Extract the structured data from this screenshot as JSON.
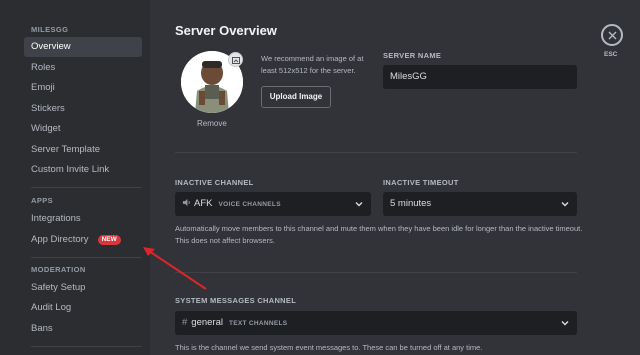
{
  "sidebar": {
    "server_header": "MILESGG",
    "items": [
      {
        "label": "Overview"
      },
      {
        "label": "Roles"
      },
      {
        "label": "Emoji"
      },
      {
        "label": "Stickers"
      },
      {
        "label": "Widget"
      },
      {
        "label": "Server Template"
      },
      {
        "label": "Custom Invite Link"
      }
    ],
    "apps_header": "APPS",
    "apps_items": [
      {
        "label": "Integrations"
      },
      {
        "label": "App Directory",
        "badge": "NEW"
      }
    ],
    "moderation_header": "MODERATION",
    "moderation_items": [
      {
        "label": "Safety Setup"
      },
      {
        "label": "Audit Log"
      },
      {
        "label": "Bans"
      }
    ]
  },
  "main": {
    "title": "Server Overview",
    "recommend_text": "We recommend an image of at least 512x512 for the server.",
    "upload_button": "Upload Image",
    "remove_label": "Remove",
    "server_name_label": "SERVER NAME",
    "server_name_value": "MilesGG",
    "inactive_channel_label": "INACTIVE CHANNEL",
    "inactive_channel_value": "AFK",
    "inactive_channel_sub": "VOICE CHANNELS",
    "inactive_timeout_label": "INACTIVE TIMEOUT",
    "inactive_timeout_value": "5 minutes",
    "inactive_help": "Automatically move members to this channel and mute them when they have been idle for longer than the inactive timeout. This does not affect browsers.",
    "system_channel_label": "SYSTEM MESSAGES CHANNEL",
    "system_channel_value": "general",
    "system_channel_sub": "TEXT CHANNELS",
    "system_help": "This is the channel we send system event messages to. These can be turned off at any time."
  },
  "close": {
    "label": "ESC"
  },
  "colors": {
    "accent_red": "#da373c",
    "annotation_arrow": "#e0242b",
    "sidebar_bg": "#2b2d31",
    "main_bg": "#313338",
    "input_bg": "#1e1f22"
  }
}
